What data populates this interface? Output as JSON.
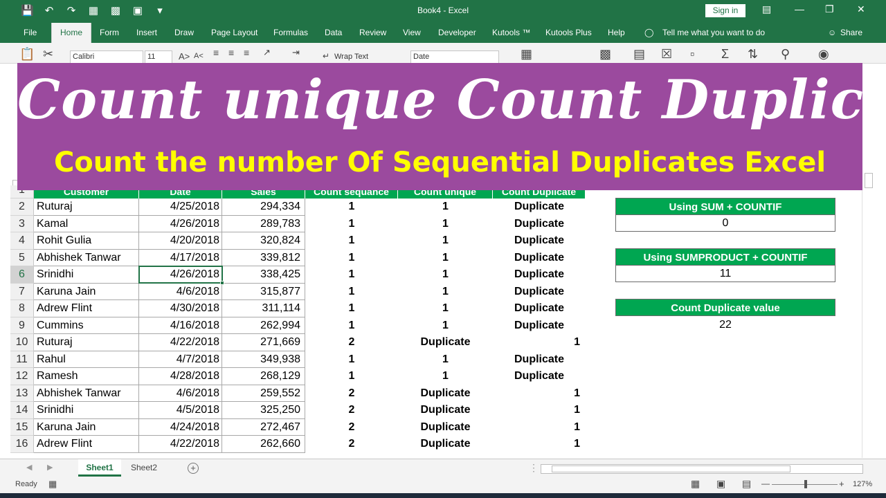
{
  "titlebar": {
    "title": "Book4  -  Excel",
    "signin": "Sign in"
  },
  "tabs": [
    "File",
    "Home",
    "Form",
    "Insert",
    "Draw",
    "Page Layout",
    "Formulas",
    "Data",
    "Review",
    "View",
    "Developer",
    "Kutools ™",
    "Kutools Plus",
    "Help"
  ],
  "tellme": "Tell me what you want to do",
  "share": "Share",
  "ribbon": {
    "font": "Calibri",
    "size": "11",
    "wrap": "Wrap Text",
    "numfmt": "Date"
  },
  "banner": {
    "title": "Count unique Count Duplicate",
    "subtitle": "Count the number Of Sequential Duplicates Excel"
  },
  "headers": {
    "row": "1",
    "customer": "Customer",
    "date": "Date",
    "sales": "Sales",
    "seq": "Count sequance",
    "uniq": "Count unique",
    "dup": "Count Duplicate"
  },
  "rows": [
    {
      "n": "2",
      "name": "Ruturaj",
      "date": "4/25/2018",
      "sales": "294,334",
      "seq": "1",
      "uniq": "1",
      "dup": "Duplicate"
    },
    {
      "n": "3",
      "name": "Kamal",
      "date": "4/26/2018",
      "sales": "289,783",
      "seq": "1",
      "uniq": "1",
      "dup": "Duplicate"
    },
    {
      "n": "4",
      "name": "Rohit Gulia",
      "date": "4/20/2018",
      "sales": "320,824",
      "seq": "1",
      "uniq": "1",
      "dup": "Duplicate"
    },
    {
      "n": "5",
      "name": "Abhishek Tanwar",
      "date": "4/17/2018",
      "sales": "339,812",
      "seq": "1",
      "uniq": "1",
      "dup": "Duplicate"
    },
    {
      "n": "6",
      "name": "Srinidhi",
      "date": "4/26/2018",
      "sales": "338,425",
      "seq": "1",
      "uniq": "1",
      "dup": "Duplicate"
    },
    {
      "n": "7",
      "name": "Karuna Jain",
      "date": "4/6/2018",
      "sales": "315,877",
      "seq": "1",
      "uniq": "1",
      "dup": "Duplicate"
    },
    {
      "n": "8",
      "name": "Adrew Flint",
      "date": "4/30/2018",
      "sales": "311,114",
      "seq": "1",
      "uniq": "1",
      "dup": "Duplicate"
    },
    {
      "n": "9",
      "name": "Cummins",
      "date": "4/16/2018",
      "sales": "262,994",
      "seq": "1",
      "uniq": "1",
      "dup": "Duplicate"
    },
    {
      "n": "10",
      "name": "Ruturaj",
      "date": "4/22/2018",
      "sales": "271,669",
      "seq": "2",
      "uniq": "Duplicate",
      "dup": "1"
    },
    {
      "n": "11",
      "name": "Rahul",
      "date": "4/7/2018",
      "sales": "349,938",
      "seq": "1",
      "uniq": "1",
      "dup": "Duplicate"
    },
    {
      "n": "12",
      "name": "Ramesh",
      "date": "4/28/2018",
      "sales": "268,129",
      "seq": "1",
      "uniq": "1",
      "dup": "Duplicate"
    },
    {
      "n": "13",
      "name": "Abhishek Tanwar",
      "date": "4/6/2018",
      "sales": "259,552",
      "seq": "2",
      "uniq": "Duplicate",
      "dup": "1"
    },
    {
      "n": "14",
      "name": "Srinidhi",
      "date": "4/5/2018",
      "sales": "325,250",
      "seq": "2",
      "uniq": "Duplicate",
      "dup": "1"
    },
    {
      "n": "15",
      "name": "Karuna Jain",
      "date": "4/24/2018",
      "sales": "272,467",
      "seq": "2",
      "uniq": "Duplicate",
      "dup": "1"
    },
    {
      "n": "16",
      "name": "Adrew Flint",
      "date": "4/22/2018",
      "sales": "262,660",
      "seq": "2",
      "uniq": "Duplicate",
      "dup": "1"
    }
  ],
  "summary": [
    {
      "label": "Using SUM + COUNTIF",
      "value": "0"
    },
    {
      "label": "Using SUMPRODUCT + COUNTIF",
      "value": "11"
    },
    {
      "label": "Count Duplicate value",
      "value": "22"
    }
  ],
  "sheets": [
    "Sheet1",
    "Sheet2"
  ],
  "status": {
    "ready": "Ready",
    "zoom": "127%"
  }
}
